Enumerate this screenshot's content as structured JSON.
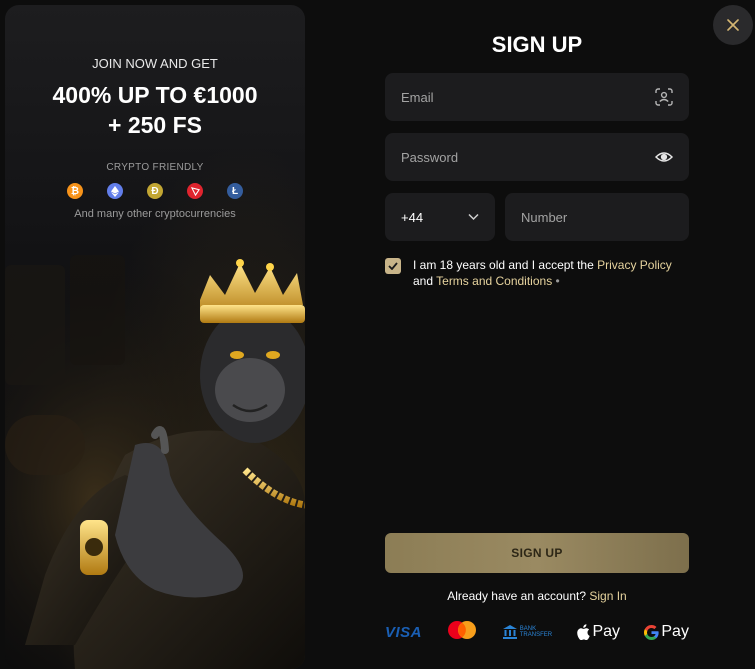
{
  "promo": {
    "kicker": "JOIN NOW AND GET",
    "headline_line1": "400% UP TO €1000",
    "headline_line2": "+ 250 FS",
    "crypto_title": "CRYPTO FRIENDLY",
    "crypto_note": "And many other cryptocurrencies",
    "coins": [
      {
        "name": "bitcoin-icon",
        "symbol": "₿",
        "color": "#f7931a"
      },
      {
        "name": "ethereum-icon",
        "symbol": "◆",
        "color": "#627eea"
      },
      {
        "name": "dogecoin-icon",
        "symbol": "Ð",
        "color": "#c2a633"
      },
      {
        "name": "tron-icon",
        "symbol": "▽",
        "color": "#e0242e"
      },
      {
        "name": "litecoin-icon",
        "symbol": "Ł",
        "color": "#345d9d"
      }
    ]
  },
  "form": {
    "title": "SIGN UP",
    "email_placeholder": "Email",
    "password_placeholder": "Password",
    "phone_prefix": "+44",
    "number_placeholder": "Number",
    "terms_text_1": "I am 18 years old and I accept the ",
    "privacy_link": "Privacy Policy",
    "terms_text_2": "and ",
    "terms_link": "Terms and Conditions",
    "required_mark": " •",
    "submit_label": "SIGN UP",
    "signin_prompt": "Already have an account? ",
    "signin_link": "Sign In"
  },
  "payments": {
    "visa": "VISA",
    "bank_line1": "BANK",
    "bank_line2": "TRANSFER",
    "apple_pay": "Pay",
    "google_pay": "Pay"
  },
  "colors": {
    "accent": "#e6d39e",
    "button": "#8c7d55",
    "background": "#0d0d0d",
    "field": "#1c1c1e"
  }
}
